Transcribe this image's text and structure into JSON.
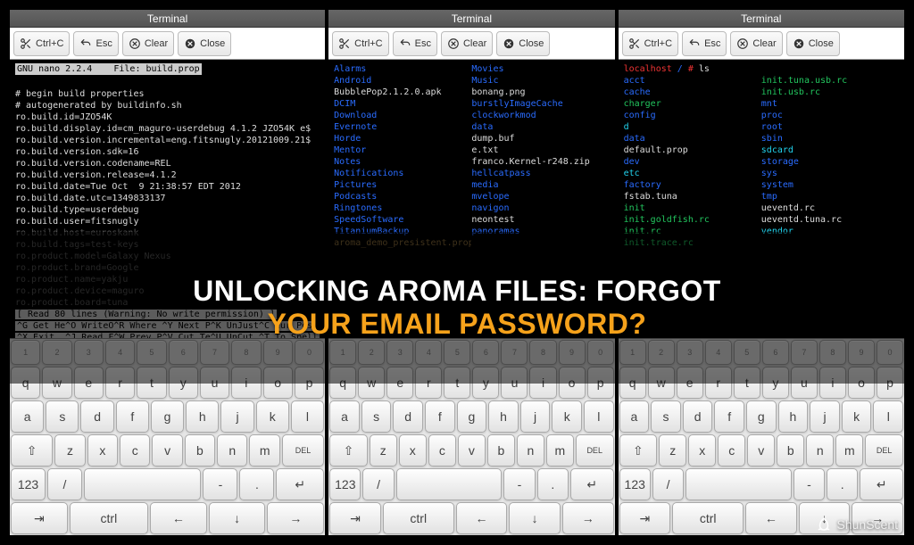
{
  "window_title": "Terminal",
  "toolbar": {
    "cut": "Ctrl+C",
    "esc": "Esc",
    "clear": "Clear",
    "close": "Close"
  },
  "overlay": {
    "line1_a": "UNLOCKING AROMA FILES: FORGOT",
    "line2_hl": "YOUR EMAIL PASSWORD?"
  },
  "watermark": {
    "text": "ShunScent"
  },
  "nano": {
    "header": "GNU nano 2.2.4    File: build.prop",
    "lines": [
      "# begin build properties",
      "# autogenerated by buildinfo.sh",
      "ro.build.id=JZO54K",
      "ro.build.display.id=cm_maguro-userdebug 4.1.2 JZO54K e$",
      "ro.build.version.incremental=eng.fitsnugly.20121009.21$",
      "ro.build.version.sdk=16",
      "ro.build.version.codename=REL",
      "ro.build.version.release=4.1.2",
      "ro.build.date=Tue Oct  9 21:38:57 EDT 2012",
      "ro.build.date.utc=1349833137",
      "ro.build.type=userdebug",
      "ro.build.user=fitsnugly"
    ],
    "dim_lines": [
      "ro.build.host=euroskank",
      "ro.build.tags=test-keys",
      "ro.product.model=Galaxy Nexus",
      "ro.product.brand=Google",
      "ro.product.name=yakju",
      "ro.product.device=maguro",
      "ro.product.board=tuna"
    ],
    "status": "[ Read 80 lines (Warning: No write permission) ]",
    "help_row1": "^G Get He^O WriteO^R Where ^Y Next P^K UnJust^C Cur Pos",
    "help_row2": "^X Exit  ^J Read F^W Prev P^V Cut Te^U UnCut ^T To Spell"
  },
  "ls_middle": {
    "rows": [
      {
        "l": {
          "t": "Alarms",
          "c": "blue"
        },
        "r": {
          "t": "Movies",
          "c": "blue"
        }
      },
      {
        "l": {
          "t": "Android",
          "c": "blue"
        },
        "r": {
          "t": "Music",
          "c": "blue"
        }
      },
      {
        "l": {
          "t": "BubblePop2.1.2.0.apk",
          "c": "white"
        },
        "r": {
          "t": "bonang.png",
          "c": "white"
        }
      },
      {
        "l": {
          "t": "DCIM",
          "c": "blue"
        },
        "r": {
          "t": "burstlyImageCache",
          "c": "blue"
        }
      },
      {
        "l": {
          "t": "Download",
          "c": "blue"
        },
        "r": {
          "t": "clockworkmod",
          "c": "blue"
        }
      },
      {
        "l": {
          "t": "Evernote",
          "c": "blue"
        },
        "r": {
          "t": "data",
          "c": "blue"
        }
      },
      {
        "l": {
          "t": "Horde",
          "c": "blue"
        },
        "r": {
          "t": "dump.buf",
          "c": "white"
        }
      },
      {
        "l": {
          "t": "Mentor",
          "c": "blue"
        },
        "r": {
          "t": "e.txt",
          "c": "white"
        }
      },
      {
        "l": {
          "t": "Notes",
          "c": "blue"
        },
        "r": {
          "t": "franco.Kernel-r248.zip",
          "c": "white"
        }
      },
      {
        "l": {
          "t": "Notifications",
          "c": "blue"
        },
        "r": {
          "t": "hellcatpass",
          "c": "blue"
        }
      },
      {
        "l": {
          "t": "Pictures",
          "c": "blue"
        },
        "r": {
          "t": "media",
          "c": "blue"
        }
      },
      {
        "l": {
          "t": "Podcasts",
          "c": "blue"
        },
        "r": {
          "t": "mvelope",
          "c": "blue"
        }
      },
      {
        "l": {
          "t": "Ringtones",
          "c": "blue"
        },
        "r": {
          "t": "navigon",
          "c": "blue"
        }
      },
      {
        "l": {
          "t": "SpeedSoftware",
          "c": "blue"
        },
        "r": {
          "t": "neontest",
          "c": "white"
        }
      },
      {
        "l": {
          "t": "TitaniumBackup",
          "c": "blue"
        },
        "r": {
          "t": "panoramas",
          "c": "blue"
        }
      },
      {
        "l": {
          "t": "aroma_demo_presistent.prop",
          "c": "brown"
        },
        "r": {
          "t": "",
          "c": "white"
        }
      }
    ]
  },
  "ls_right": {
    "prompt_user": "localhost",
    "prompt_path": "/",
    "prompt_char": "#",
    "cmd": "ls",
    "rows": [
      {
        "l": {
          "t": "acct",
          "c": "blue"
        },
        "r": {
          "t": "init.tuna.usb.rc",
          "c": "green"
        }
      },
      {
        "l": {
          "t": "cache",
          "c": "blue"
        },
        "r": {
          "t": "init.usb.rc",
          "c": "green"
        }
      },
      {
        "l": {
          "t": "charger",
          "c": "green"
        },
        "r": {
          "t": "mnt",
          "c": "blue"
        }
      },
      {
        "l": {
          "t": "config",
          "c": "blue"
        },
        "r": {
          "t": "proc",
          "c": "blue"
        }
      },
      {
        "l": {
          "t": "d",
          "c": "cyan"
        },
        "r": {
          "t": "root",
          "c": "blue"
        }
      },
      {
        "l": {
          "t": "data",
          "c": "blue"
        },
        "r": {
          "t": "sbin",
          "c": "blue"
        }
      },
      {
        "l": {
          "t": "default.prop",
          "c": "white"
        },
        "r": {
          "t": "sdcard",
          "c": "cyan"
        }
      },
      {
        "l": {
          "t": "dev",
          "c": "blue"
        },
        "r": {
          "t": "storage",
          "c": "blue"
        }
      },
      {
        "l": {
          "t": "etc",
          "c": "cyan"
        },
        "r": {
          "t": "sys",
          "c": "blue"
        }
      },
      {
        "l": {
          "t": "factory",
          "c": "blue"
        },
        "r": {
          "t": "system",
          "c": "blue"
        }
      },
      {
        "l": {
          "t": "fstab.tuna",
          "c": "white"
        },
        "r": {
          "t": "tmp",
          "c": "blue"
        }
      },
      {
        "l": {
          "t": "init",
          "c": "green"
        },
        "r": {
          "t": "ueventd.rc",
          "c": "white"
        }
      },
      {
        "l": {
          "t": "init.goldfish.rc",
          "c": "green"
        },
        "r": {
          "t": "ueventd.tuna.rc",
          "c": "white"
        }
      },
      {
        "l": {
          "t": "init.rc",
          "c": "green"
        },
        "r": {
          "t": "vendor",
          "c": "cyan"
        }
      },
      {
        "l": {
          "t": "init.trace.rc",
          "c": "green"
        },
        "r": {
          "t": "",
          "c": "white"
        }
      }
    ]
  },
  "keyboard": {
    "num": [
      "1",
      "2",
      "3",
      "4",
      "5",
      "6",
      "7",
      "8",
      "9",
      "0"
    ],
    "row1": [
      "q",
      "w",
      "e",
      "r",
      "t",
      "y",
      "u",
      "i",
      "o",
      "p"
    ],
    "row2": [
      "a",
      "s",
      "d",
      "f",
      "g",
      "h",
      "j",
      "k",
      "l"
    ],
    "row3": [
      "⇧",
      "z",
      "x",
      "c",
      "v",
      "b",
      "n",
      "m",
      "⌦"
    ],
    "del_label": "DEL",
    "row4": [
      "123",
      "/",
      "space",
      "-",
      ".",
      "↵"
    ],
    "row5": [
      "⇥",
      "ctrl",
      "←",
      "↓",
      "→"
    ]
  }
}
